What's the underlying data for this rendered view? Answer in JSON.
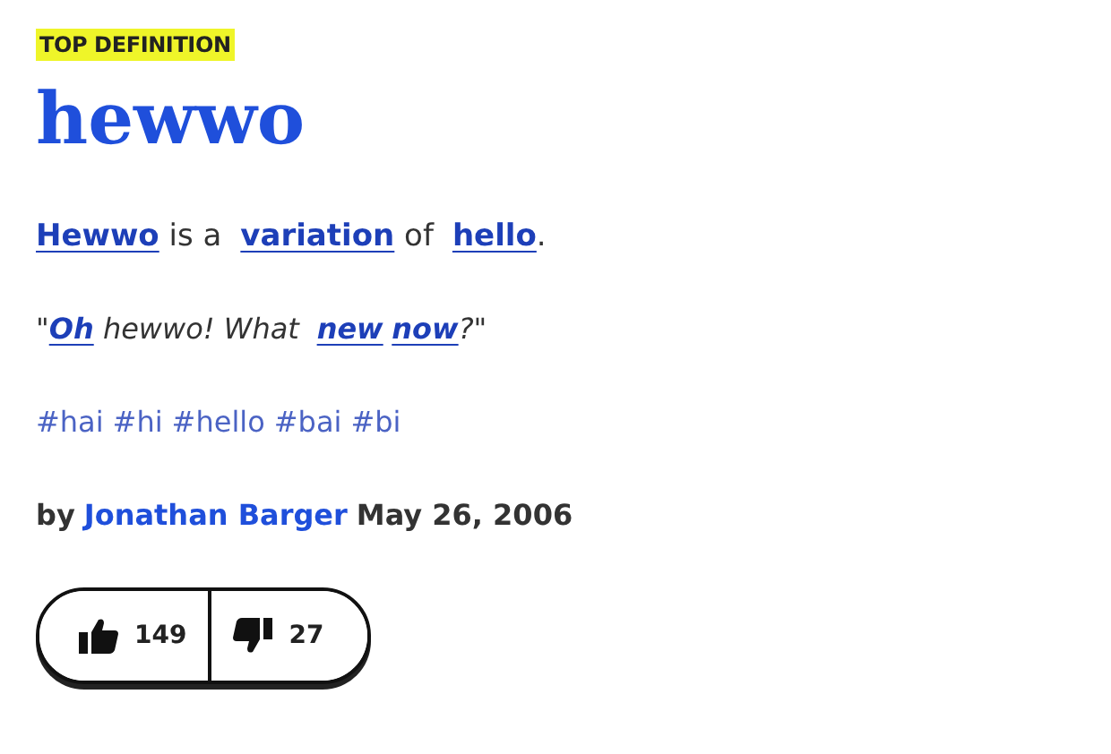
{
  "badge": "TOP DEFINITION",
  "word": "hewwo",
  "meaning": [
    {
      "kind": "link",
      "text": "Hewwo"
    },
    {
      "kind": "text",
      "text": " is a "
    },
    {
      "kind": "link",
      "text": "variation"
    },
    {
      "kind": "text",
      "text": " of "
    },
    {
      "kind": "link",
      "text": "hello"
    },
    {
      "kind": "text",
      "text": "."
    }
  ],
  "example": [
    {
      "kind": "text",
      "text": "\""
    },
    {
      "kind": "link",
      "text": "Oh"
    },
    {
      "kind": "text",
      "text": " hewwo! What "
    },
    {
      "kind": "link",
      "text": "new"
    },
    {
      "kind": "link",
      "text": "now"
    },
    {
      "kind": "text",
      "text": "?\""
    }
  ],
  "tags": [
    "#hai",
    "#hi",
    "#hello",
    "#bai",
    "#bi"
  ],
  "byline": {
    "prefix": "by",
    "author": "Jonathan Barger",
    "date": "May 26, 2006"
  },
  "votes": {
    "up": "149",
    "down": "27"
  }
}
